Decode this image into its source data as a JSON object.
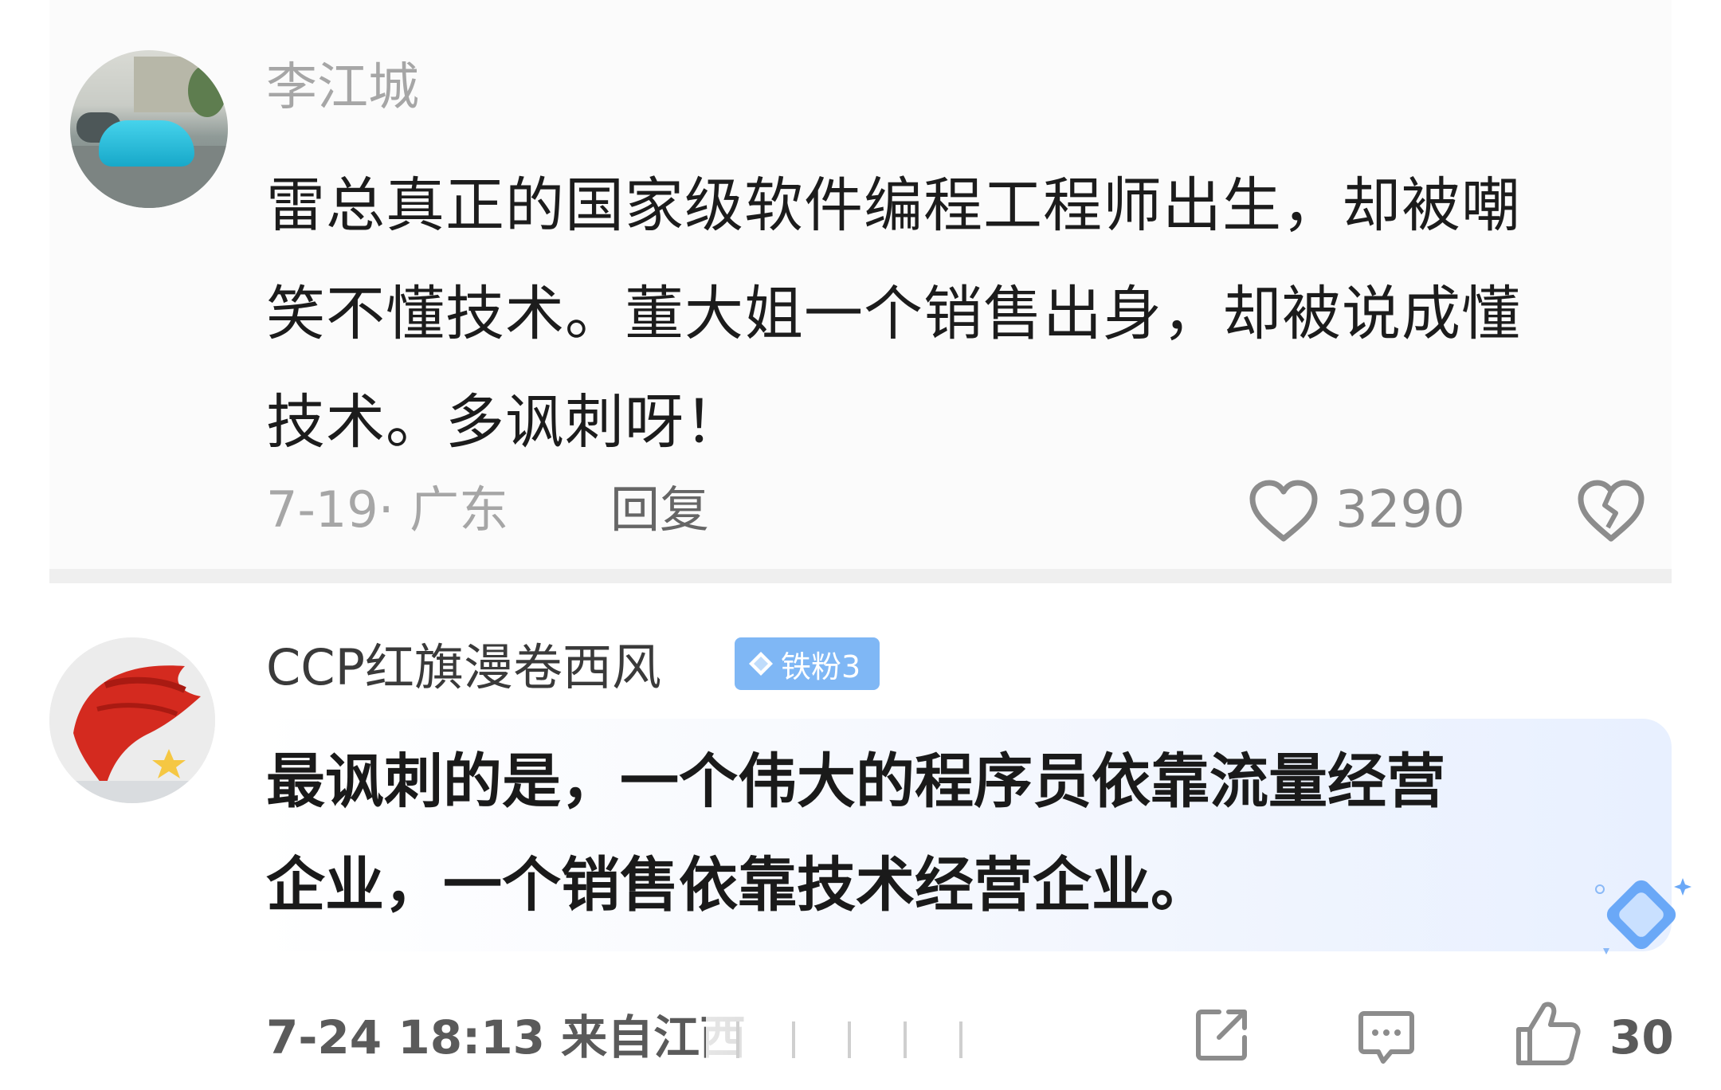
{
  "comments": [
    {
      "username": "李江城",
      "text_lines": [
        "雷总真正的国家级软件编程工程师出生，却被嘲",
        "笑不懂技术。董大姐一个销售出身，却被说成懂",
        "技术。多讽刺呀！"
      ],
      "date_location": "7-19· 广东",
      "reply_label": "回复",
      "like_count": "3290",
      "icons": [
        "heart-icon",
        "broken-heart-icon"
      ]
    },
    {
      "username": "CCP红旗漫卷西风",
      "badge_label": "铁粉3",
      "text_lines": [
        "最讽刺的是，一个伟大的程序员依靠流量经营",
        "企业，一个销售依靠技术经营企业。"
      ],
      "timestamp_source": "7-24 18:13 来自江西",
      "like_count": "30",
      "icons": [
        "share-icon",
        "comment-icon",
        "thumbs-up-icon"
      ]
    }
  ],
  "colors": {
    "badge": "#7fb7f5",
    "muted_text": "#a6a6a6",
    "body_text": "#1c1c1c"
  }
}
